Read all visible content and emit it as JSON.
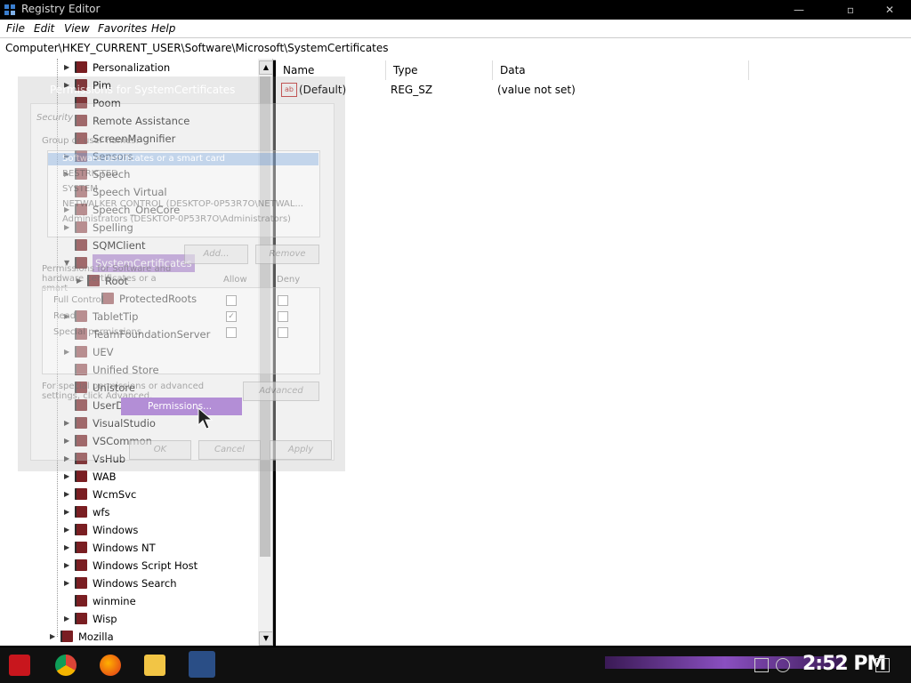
{
  "window": {
    "title": "Registry Editor"
  },
  "menu": [
    "File",
    "Edit",
    "View",
    "Favorites",
    "Help"
  ],
  "address": "Computer\\HKEY_CURRENT_USER\\Software\\Microsoft\\SystemCertificates",
  "tree": [
    {
      "label": "Personalization",
      "expand": true
    },
    {
      "label": "Pim",
      "expand": true
    },
    {
      "label": "Poom",
      "expand": false
    },
    {
      "label": "Remote Assistance",
      "expand": false
    },
    {
      "label": "ScreenMagnifier",
      "expand": false
    },
    {
      "label": "Sensors",
      "expand": true
    },
    {
      "label": "Speech",
      "expand": true
    },
    {
      "label": "Speech Virtual",
      "expand": false
    },
    {
      "label": "Speech_OneCore",
      "expand": true
    },
    {
      "label": "Spelling",
      "expand": true
    },
    {
      "label": "SQMClient",
      "expand": false
    },
    {
      "label": "SystemCertificates",
      "expand": true,
      "selected": true
    },
    {
      "label": "Root",
      "expand": true,
      "child": true
    },
    {
      "label": "ProtectedRoots",
      "expand": false,
      "child2": true
    },
    {
      "label": "TabletTip",
      "expand": true
    },
    {
      "label": "TeamFoundationServer",
      "expand": false
    },
    {
      "label": "UEV",
      "expand": true
    },
    {
      "label": "Unified Store",
      "expand": false
    },
    {
      "label": "Unistore",
      "expand": false
    },
    {
      "label": "UserData",
      "expand": false
    },
    {
      "label": "VisualStudio",
      "expand": true
    },
    {
      "label": "VSCommon",
      "expand": true
    },
    {
      "label": "VsHub",
      "expand": true
    },
    {
      "label": "WAB",
      "expand": true
    },
    {
      "label": "WcmSvc",
      "expand": true
    },
    {
      "label": "wfs",
      "expand": true
    },
    {
      "label": "Windows",
      "expand": true
    },
    {
      "label": "Windows NT",
      "expand": true
    },
    {
      "label": "Windows Script Host",
      "expand": true
    },
    {
      "label": "Windows Search",
      "expand": true
    },
    {
      "label": "winmine",
      "expand": false
    },
    {
      "label": "Wisp",
      "expand": true
    },
    {
      "label": "Mozilla",
      "expand": true,
      "parent": true
    }
  ],
  "list": {
    "columns": [
      "Name",
      "Type",
      "Data"
    ],
    "rows": [
      {
        "name": "(Default)",
        "type": "REG_SZ",
        "data": "(value not set)",
        "icon": "ab"
      }
    ]
  },
  "dialog": {
    "title": "Permissions for SystemCertificates",
    "tab": "Security",
    "group_label": "Group or user names:",
    "users": [
      "Software certificates or a smart card",
      "RESTRICTED",
      "SYSTEM",
      "NETWALKER CONTROL (DESKTOP-0P53R7O\\NETWAL...",
      "Administrators (DESKTOP-0P53R7O\\Administrators)"
    ],
    "add": "Add...",
    "remove": "Remove",
    "perm_label": "Permissions for Software and hardware certificates or a smart",
    "allow": "Allow",
    "deny": "Deny",
    "perms": [
      "Full Control",
      "Read",
      "Special permissions"
    ],
    "adv_text": "For special permissions or advanced settings, click Advanced.",
    "advanced": "Advanced",
    "ok": "OK",
    "cancel": "Cancel",
    "apply": "Apply",
    "permissions_menu": "Permissions..."
  },
  "taskbar": {
    "clock": "2:52 PM"
  }
}
